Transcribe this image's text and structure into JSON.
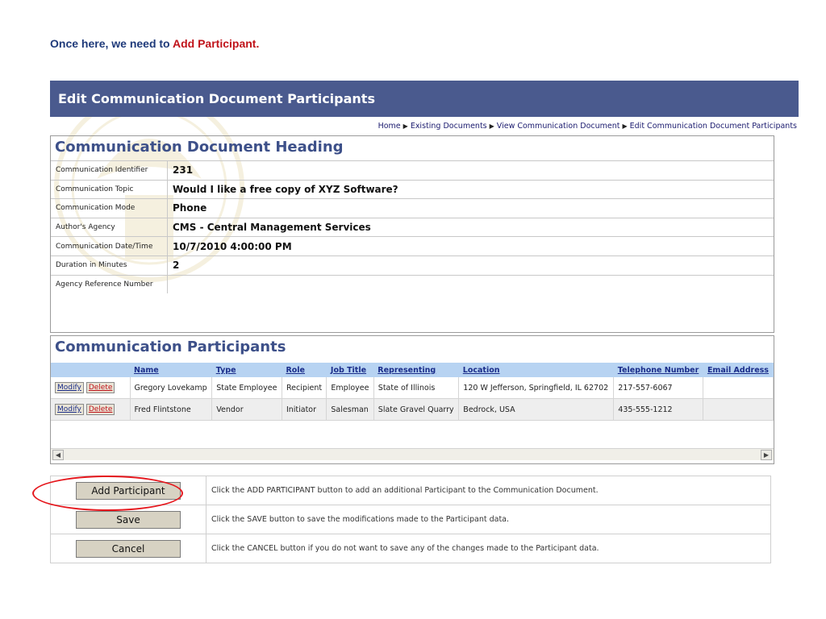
{
  "instruction": {
    "prefix": "Once here, we need to ",
    "highlight": "Add Participant."
  },
  "header": {
    "title": "Edit Communication Document Participants"
  },
  "breadcrumb": [
    "Home",
    "Existing Documents",
    "View Communication Document",
    "Edit Communication Document Participants"
  ],
  "heading_section": {
    "title": "Communication Document Heading",
    "fields": [
      {
        "label": "Communication Identifier",
        "value": "231"
      },
      {
        "label": "Communication Topic",
        "value": "Would I like a free copy of XYZ Software?"
      },
      {
        "label": "Communication Mode",
        "value": "Phone"
      },
      {
        "label": "Author's Agency",
        "value": "CMS - Central Management Services"
      },
      {
        "label": "Communication Date/Time",
        "value": "10/7/2010 4:00:00 PM"
      },
      {
        "label": "Duration in Minutes",
        "value": "2"
      },
      {
        "label": "Agency Reference Number",
        "value": ""
      }
    ]
  },
  "participants_section": {
    "title": "Communication Participants",
    "columns": [
      "",
      "Name",
      "Type",
      "Role",
      "Job Title",
      "Representing",
      "Location",
      "Telephone Number",
      "Email Address"
    ],
    "modify_label": "Modify",
    "delete_label": "Delete",
    "rows": [
      {
        "name": "Gregory Lovekamp",
        "type": "State Employee",
        "role": "Recipient",
        "job_title": "Employee",
        "representing": "State of Illinois",
        "location": "120 W Jefferson, Springfield, IL 62702",
        "telephone": "217-557-6067",
        "email": ""
      },
      {
        "name": "Fred Flintstone",
        "type": "Vendor",
        "role": "Initiator",
        "job_title": "Salesman",
        "representing": "Slate Gravel Quarry",
        "location": "Bedrock, USA",
        "telephone": "435-555-1212",
        "email": ""
      }
    ]
  },
  "actions": [
    {
      "label": "Add Participant",
      "description": "Click the ADD PARTICIPANT button to add an additional Participant to the Communication Document."
    },
    {
      "label": "Save",
      "description": "Click the SAVE button to save the modifications made to the Participant data."
    },
    {
      "label": "Cancel",
      "description": "Click the CANCEL button if you do not want to save any of the changes made to the Participant data."
    }
  ],
  "colors": {
    "header_bg": "#4a5a8e",
    "section_title": "#3d5089",
    "highlight_oval": "#e5161c",
    "instruction_text": "#1f3a7a",
    "instruction_highlight": "#c0131a",
    "grid_header_bg": "#b7d3f2"
  },
  "icons": {
    "breadcrumb_separator": "triangle-right-icon",
    "scroll_left": "arrow-left-icon",
    "scroll_right": "arrow-right-icon"
  }
}
